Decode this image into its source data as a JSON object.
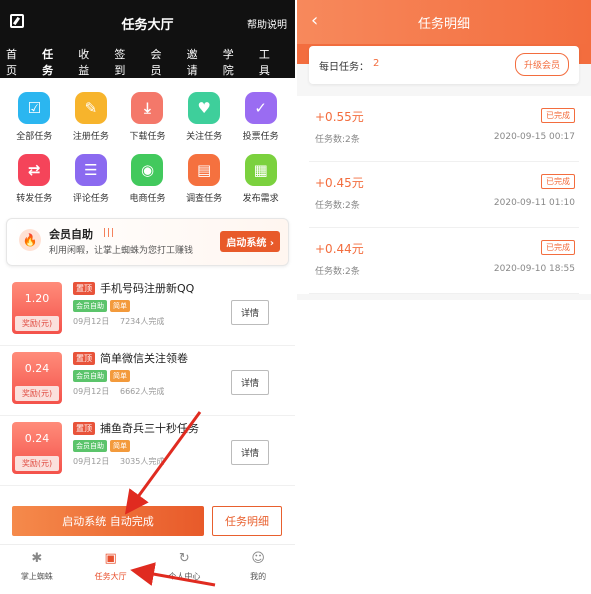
{
  "left": {
    "header": {
      "title": "任务大厅",
      "help": "帮助说明"
    },
    "tabs": [
      "首页",
      "任务",
      "收益",
      "签到",
      "会员",
      "邀请",
      "学院",
      "工具"
    ],
    "grid": [
      {
        "label": "全部任务",
        "icon": "clipboard-icon",
        "color": "#2bb6f0",
        "glyph": "☑"
      },
      {
        "label": "注册任务",
        "icon": "edit-note-icon",
        "color": "#f7b42c",
        "glyph": "✎"
      },
      {
        "label": "下载任务",
        "icon": "download-icon",
        "color": "#f4786a",
        "glyph": "⤓"
      },
      {
        "label": "关注任务",
        "icon": "heart-icon",
        "color": "#3ecf9b",
        "glyph": "♥"
      },
      {
        "label": "投票任务",
        "icon": "thumbs-up-icon",
        "color": "#9a6cf2",
        "glyph": "✓"
      },
      {
        "label": "转发任务",
        "icon": "repost-icon",
        "color": "#f5445a",
        "glyph": "⇄"
      },
      {
        "label": "评论任务",
        "icon": "comment-icon",
        "color": "#8b6af0",
        "glyph": "☰"
      },
      {
        "label": "电商任务",
        "icon": "ecommerce-icon",
        "color": "#42c95d",
        "glyph": "◉"
      },
      {
        "label": "调查任务",
        "icon": "survey-icon",
        "color": "#f5713f",
        "glyph": "▤"
      },
      {
        "label": "发布需求",
        "icon": "document-icon",
        "color": "#7bd13e",
        "glyph": "▦"
      }
    ],
    "banner": {
      "title": "会员自助",
      "bars": "|||",
      "desc": "利用闲暇，让掌上蜘蛛为您打工赚钱",
      "button": "启动系统 ›"
    },
    "tasks": [
      {
        "reward": "1.20",
        "unit": "奖励(元)",
        "top": "置顶",
        "name": "手机号码注册新QQ",
        "tag1": "会员自助",
        "tag2": "简单",
        "date": "09月12日",
        "done": "7234人完成",
        "detail": "详情"
      },
      {
        "reward": "0.24",
        "unit": "奖励(元)",
        "top": "置顶",
        "name": "简单微信关注领卷",
        "tag1": "会员自助",
        "tag2": "简单",
        "date": "09月12日",
        "done": "6662人完成",
        "detail": "详情"
      },
      {
        "reward": "0.24",
        "unit": "奖励(元)",
        "top": "置顶",
        "name": "捕鱼奇兵三十秒任务",
        "tag1": "会员自助",
        "tag2": "简单",
        "date": "09月12日",
        "done": "3035人完成",
        "detail": "详情"
      }
    ],
    "actions": {
      "start": "启动系统 自动完成",
      "detail": "任务明细"
    },
    "nav": [
      {
        "label": "掌上蜘蛛",
        "icon": "spider-icon",
        "glyph": "✱"
      },
      {
        "label": "任务大厅",
        "icon": "task-hall-icon",
        "glyph": "▣"
      },
      {
        "label": "个人中心",
        "icon": "refresh-icon",
        "glyph": "↻"
      },
      {
        "label": "我的",
        "icon": "user-icon",
        "glyph": "☺"
      }
    ]
  },
  "right": {
    "header": {
      "back": "‹",
      "title": "任务明细"
    },
    "daily": {
      "label": "每日任务：",
      "value": "2",
      "upgrade": "升级会员"
    },
    "records": [
      {
        "amount": "+0.55元",
        "status": "已完成",
        "count": "任务数:2条",
        "time": "2020-09-15 00:17"
      },
      {
        "amount": "+0.45元",
        "status": "已完成",
        "count": "任务数:2条",
        "time": "2020-09-11 01:10"
      },
      {
        "amount": "+0.44元",
        "status": "已完成",
        "count": "任务数:2条",
        "time": "2020-09-10 18:55"
      }
    ]
  }
}
